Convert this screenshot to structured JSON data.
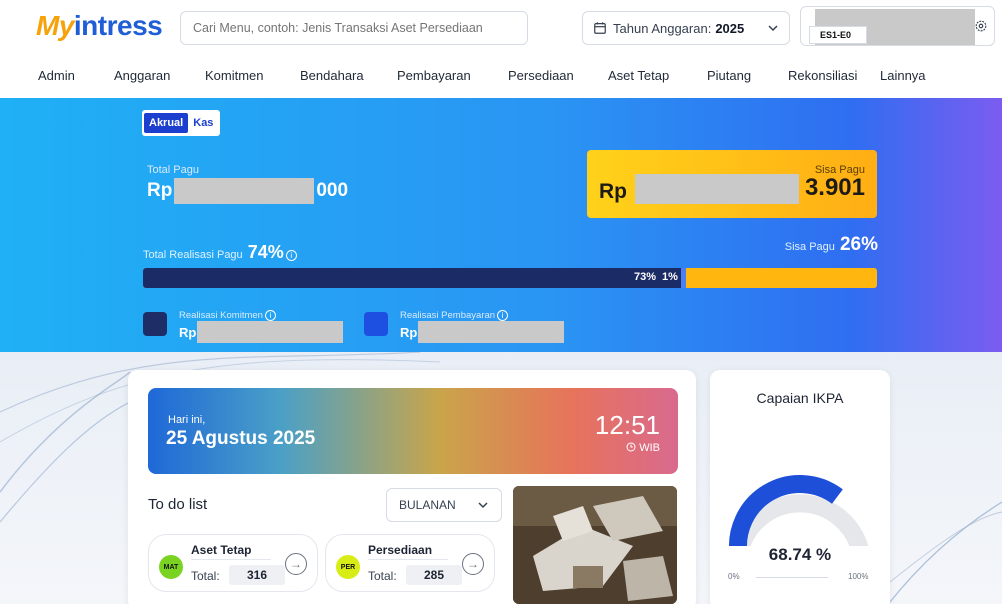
{
  "header": {
    "logo_my": "My",
    "logo_rest": "intress",
    "search_placeholder": "Cari Menu, contoh: Jenis Transaksi Aset Persediaan",
    "year_label": "Tahun Anggaran:",
    "year_value": "2025",
    "unit_code": "ES1-E0"
  },
  "nav": {
    "items": [
      "Admin",
      "Anggaran",
      "Komitmen",
      "Bendahara",
      "Pembayaran",
      "Persediaan",
      "Aset Tetap",
      "Piutang",
      "Rekonsiliasi",
      "Lainnya"
    ]
  },
  "hero": {
    "toggle_active": "Akrual",
    "toggle_inactive": "Kas",
    "total_pagu_label": "Total Pagu",
    "total_pagu_prefix": "Rp",
    "total_pagu_suffix": "000",
    "sisa_pagu_card_label": "Sisa Pagu",
    "sisa_pagu_prefix": "Rp",
    "sisa_pagu_suffix": "3.901",
    "realisasi_label": "Total Realisasi Pagu",
    "realisasi_pct": "74%",
    "sisa_label": "Sisa Pagu",
    "sisa_pct": "26%",
    "progress_fraction": 0.74,
    "progress_text_a": "73%",
    "progress_text_b": "1%",
    "legend_komitmen_label": "Realisasi Komitmen",
    "legend_komitmen_prefix": "Rp",
    "legend_pembayaran_label": "Realisasi Pembayaran",
    "legend_pembayaran_prefix": "Rp"
  },
  "today": {
    "greeting": "Hari ini,",
    "date": "25 Agustus 2025",
    "time": "12:51",
    "zone": "WIB"
  },
  "todo": {
    "title": "To do list",
    "period": "BULANAN",
    "items": [
      {
        "badge": "MAT",
        "name": "Aset Tetap",
        "total_label": "Total:",
        "count": "316",
        "badge_color": "#7bd321"
      },
      {
        "badge": "PER",
        "name": "Persediaan",
        "total_label": "Total:",
        "count": "285",
        "badge_color": "#d8ec16"
      }
    ]
  },
  "ikpa": {
    "title": "Capaian IKPA",
    "value_text": "68.74 %",
    "value": 68.74,
    "min": "0%",
    "max": "100%"
  },
  "colors": {
    "brand_orange": "#f5a20b",
    "brand_blue": "#1f5ed6",
    "progress_fill": "#1a2b66",
    "progress_rest": "#ffb70f",
    "legend_komitmen": "#1e2d66",
    "legend_pembayaran": "#1d4fe0"
  }
}
